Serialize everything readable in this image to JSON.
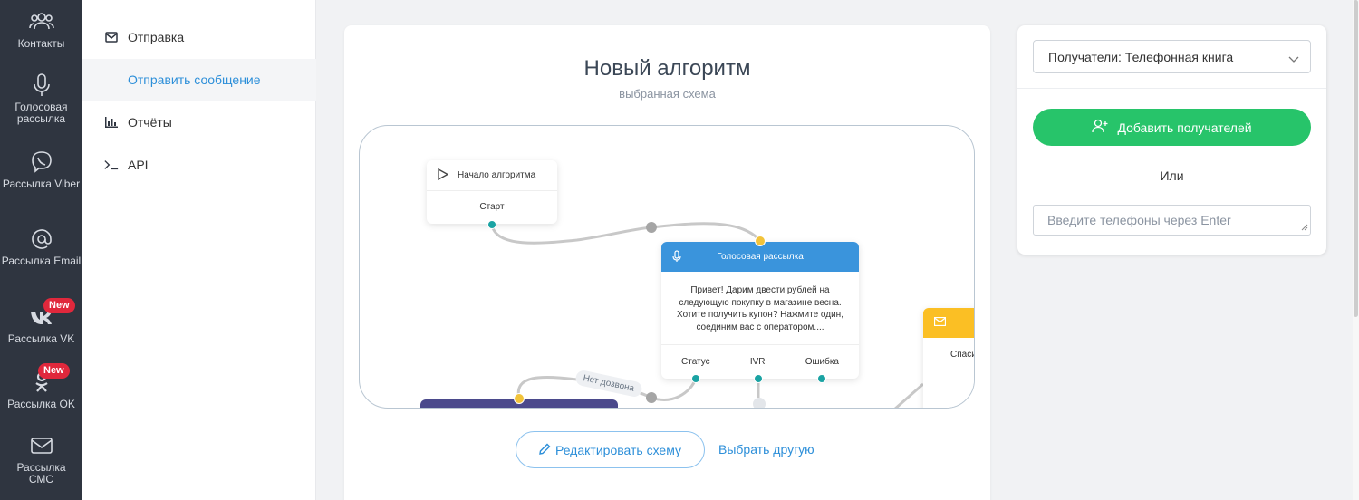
{
  "rail": {
    "items": [
      {
        "label": "Контакты",
        "icon": "contacts-icon"
      },
      {
        "label": "Голосовая рассылка",
        "icon": "microphone-icon"
      },
      {
        "label": "Рассылка Viber",
        "icon": "viber-icon"
      },
      {
        "label": "Рассылка Email",
        "icon": "at-icon"
      },
      {
        "label": "Рассылка VK",
        "icon": "vk-icon",
        "badge": "New"
      },
      {
        "label": "Рассылка OK",
        "icon": "ok-icon",
        "badge": "New"
      },
      {
        "label": "Рассылка СМС",
        "icon": "envelope-icon"
      }
    ]
  },
  "subnav": {
    "items": [
      {
        "label": "Отправка",
        "icon": "envelope-icon"
      },
      {
        "label": "Отправить сообщение",
        "active": true
      },
      {
        "label": "Отчёты",
        "icon": "bar-chart-icon"
      },
      {
        "label": "API",
        "icon": "terminal-icon"
      }
    ]
  },
  "main": {
    "title": "Новый алгоритм",
    "subtitle": "выбранная схема",
    "edit_button": "Редактировать схему",
    "choose_other": "Выбрать другую",
    "scheme": {
      "start_node": {
        "title": "Начало алгоритма",
        "output": "Старт"
      },
      "voice_node": {
        "title": "Голосовая рассылка",
        "text": "Привет! Дарим двести рублей на следующую покупку в магазине весна. Хотите получить купон? Нажмите один, соединим вас с оператором....",
        "outputs": [
          "Статус",
          "IVR",
          "Ошибка"
        ]
      },
      "edge_label": "Нет дозвона",
      "right_node_text": "Спаси"
    }
  },
  "right": {
    "recipients_select": "Получатели: Телефонная книга",
    "add_button": "Добавить получателей",
    "or_label": "Или",
    "phones_placeholder": "Введите телефоны через Enter"
  },
  "colors": {
    "accent": "#2d8fd9",
    "green": "#27c46a",
    "rail": "#2f3540",
    "voice_header": "#3a94dc",
    "email_header": "#fbbf24",
    "port_teal": "#1aa3a3",
    "port_yellow": "#f2c33a"
  }
}
